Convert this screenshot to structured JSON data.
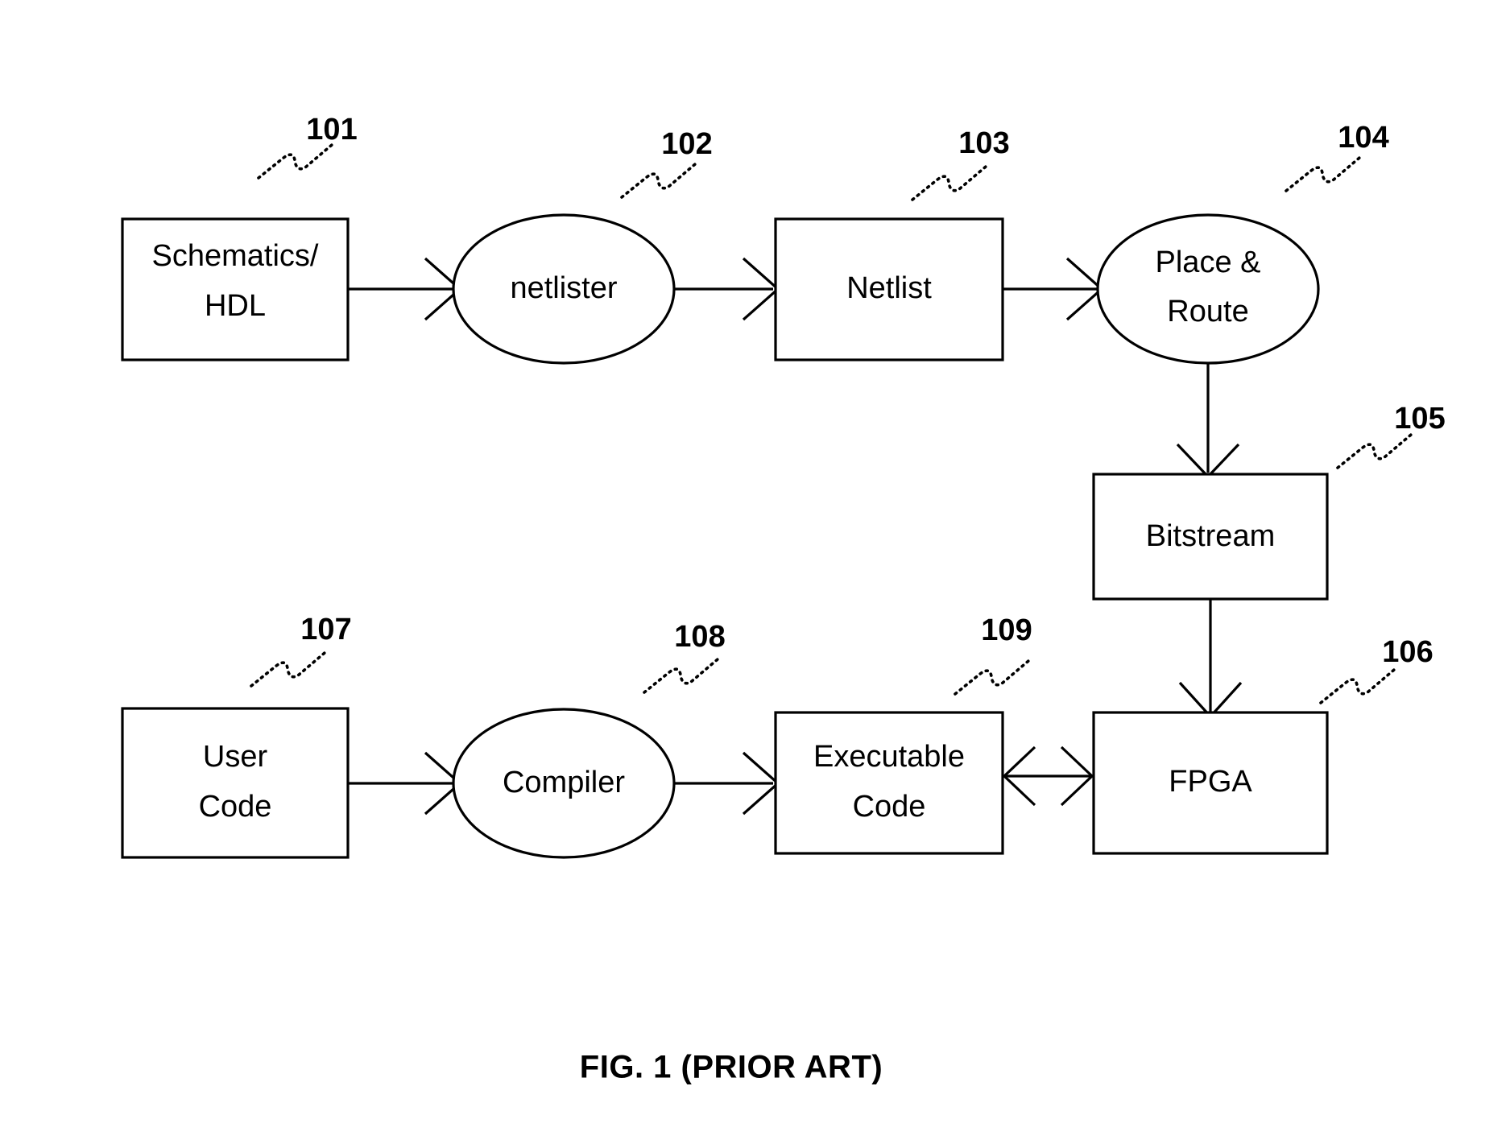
{
  "figure": {
    "caption": "FIG. 1 (PRIOR ART)",
    "background_color": "#ffffff",
    "line_color": "#000000"
  },
  "nodes": [
    {
      "id": "schematics_hdl",
      "shape": "rect",
      "line1": "Schematics/",
      "line2": "HDL",
      "ref": "101"
    },
    {
      "id": "netlister",
      "shape": "ellipse",
      "line1": "netlister",
      "line2": "",
      "ref": "102"
    },
    {
      "id": "netlist",
      "shape": "rect",
      "line1": "Netlist",
      "line2": "",
      "ref": "103"
    },
    {
      "id": "place_route",
      "shape": "ellipse",
      "line1": "Place &",
      "line2": "Route",
      "ref": "104"
    },
    {
      "id": "bitstream",
      "shape": "rect",
      "line1": "Bitstream",
      "line2": "",
      "ref": "105"
    },
    {
      "id": "fpga",
      "shape": "rect",
      "line1": "FPGA",
      "line2": "",
      "ref": "106"
    },
    {
      "id": "user_code",
      "shape": "rect",
      "line1": "User",
      "line2": "Code",
      "ref": "107"
    },
    {
      "id": "compiler",
      "shape": "ellipse",
      "line1": "Compiler",
      "line2": "",
      "ref": "108"
    },
    {
      "id": "executable_code",
      "shape": "rect",
      "line1": "Executable",
      "line2": "Code",
      "ref": "109"
    }
  ],
  "connections": [
    {
      "from": "schematics_hdl",
      "to": "netlister",
      "direction": "forward"
    },
    {
      "from": "netlister",
      "to": "netlist",
      "direction": "forward"
    },
    {
      "from": "netlist",
      "to": "place_route",
      "direction": "forward"
    },
    {
      "from": "place_route",
      "to": "bitstream",
      "direction": "forward"
    },
    {
      "from": "bitstream",
      "to": "fpga",
      "direction": "forward"
    },
    {
      "from": "user_code",
      "to": "compiler",
      "direction": "forward"
    },
    {
      "from": "compiler",
      "to": "executable_code",
      "direction": "forward"
    },
    {
      "from": "executable_code",
      "to": "fpga",
      "direction": "bidirectional"
    }
  ]
}
